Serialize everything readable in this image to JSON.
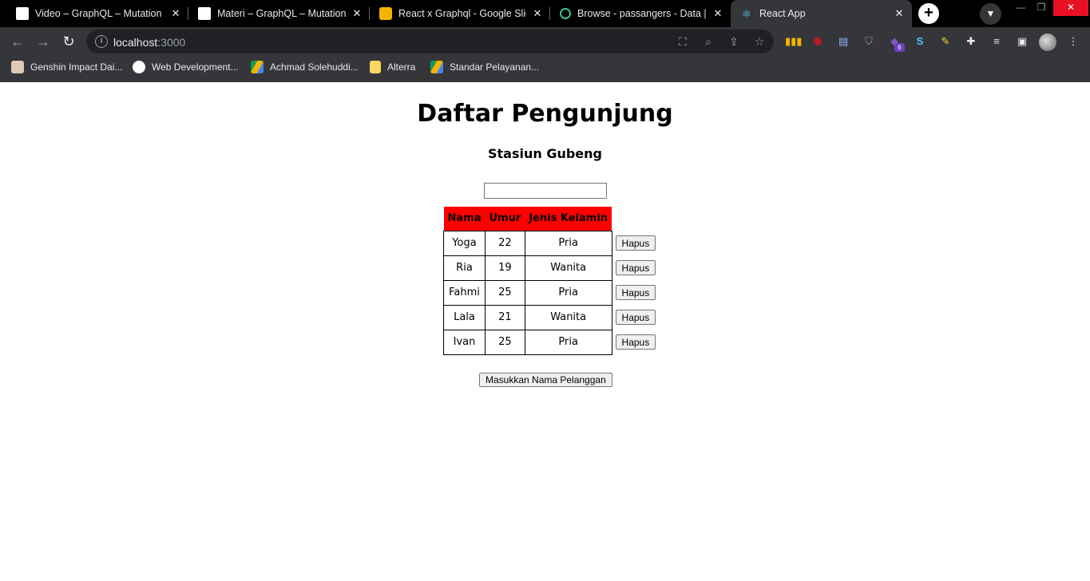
{
  "browser": {
    "tabs": [
      {
        "title": "Video – GraphQL – Mutation",
        "favicon": "white-page-icon"
      },
      {
        "title": "Materi – GraphQL – Mutation",
        "favicon": "white-page-icon"
      },
      {
        "title": "React x Graphql - Google Slides",
        "favicon": "google-slides-icon"
      },
      {
        "title": "Browse - passangers - Data | Hasura",
        "favicon": "hasura-icon"
      },
      {
        "title": "React App",
        "favicon": "react-icon"
      }
    ],
    "url_host": "localhost",
    "url_port": ":3000",
    "extension_badge": "6",
    "bookmarks": [
      {
        "label": "Genshin Impact Dai...",
        "icon": "genshin-icon"
      },
      {
        "label": "Web Development...",
        "icon": "web-dev-icon"
      },
      {
        "label": "Achmad Solehuddi...",
        "icon": "google-drive-icon"
      },
      {
        "label": "Alterra",
        "icon": "folder-icon"
      },
      {
        "label": "Standar Pelayanan...",
        "icon": "google-drive-icon"
      }
    ]
  },
  "page": {
    "title": "Daftar Pengunjung",
    "subtitle": "Stasiun Gubeng",
    "input_value": "",
    "table": {
      "headers": [
        "Nama",
        "Umur",
        "Jenis Kelamin"
      ],
      "header_color": "#ff0000",
      "rows": [
        {
          "nama": "Yoga",
          "umur": "22",
          "jenis_kelamin": "Pria"
        },
        {
          "nama": "Ria",
          "umur": "19",
          "jenis_kelamin": "Wanita"
        },
        {
          "nama": "Fahmi",
          "umur": "25",
          "jenis_kelamin": "Pria"
        },
        {
          "nama": "Lala",
          "umur": "21",
          "jenis_kelamin": "Wanita"
        },
        {
          "nama": "Ivan",
          "umur": "25",
          "jenis_kelamin": "Pria"
        }
      ],
      "delete_label": "Hapus"
    },
    "submit_label": "Masukkan Nama Pelanggan"
  }
}
